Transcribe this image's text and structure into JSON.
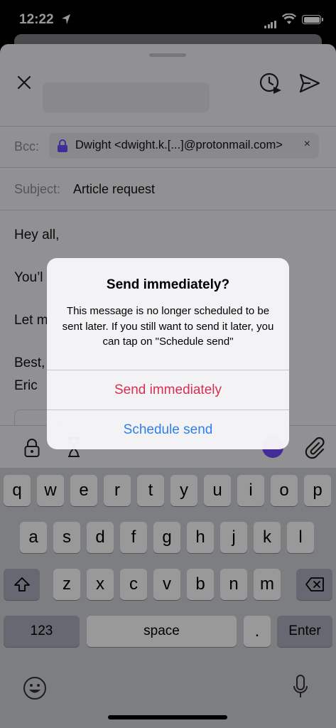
{
  "status_bar": {
    "time": "12:22"
  },
  "compose": {
    "bcc_label": "Bcc:",
    "bcc_chip": "Dwight <dwight.k.[...]@protonmail.com>",
    "bcc_chip_remove": "×",
    "subject_label": "Subject:",
    "subject_value": "Article request",
    "body_lines": [
      "Hey all,",
      "You’l",
      "Let m",
      "Best,",
      "Eric"
    ]
  },
  "keyboard": {
    "row1": [
      "q",
      "w",
      "e",
      "r",
      "t",
      "y",
      "u",
      "i",
      "o",
      "p"
    ],
    "row2": [
      "a",
      "s",
      "d",
      "f",
      "g",
      "h",
      "j",
      "k",
      "l"
    ],
    "row3": [
      "z",
      "x",
      "c",
      "v",
      "b",
      "n",
      "m"
    ],
    "numbers_label": "123",
    "space_label": "space",
    "period_label": ".",
    "enter_label": "Enter"
  },
  "alert": {
    "title": "Send immediately?",
    "message": "This message is no longer scheduled to be sent later. If you still want to send it later, you can tap on \"Schedule send\"",
    "primary_label": "Send immediately",
    "secondary_label": "Schedule send"
  },
  "colors": {
    "destructive": "#d5304f",
    "action": "#2f7fe6",
    "brand": "#6d4aff"
  },
  "icons": [
    "location-arrow-icon",
    "signal-icon",
    "wifi-icon",
    "battery-icon",
    "close-icon",
    "schedule-clock-icon",
    "send-icon",
    "lock-icon",
    "hourglass-icon",
    "paperclip-icon",
    "shift-icon",
    "backspace-icon",
    "emoji-icon",
    "microphone-icon"
  ]
}
